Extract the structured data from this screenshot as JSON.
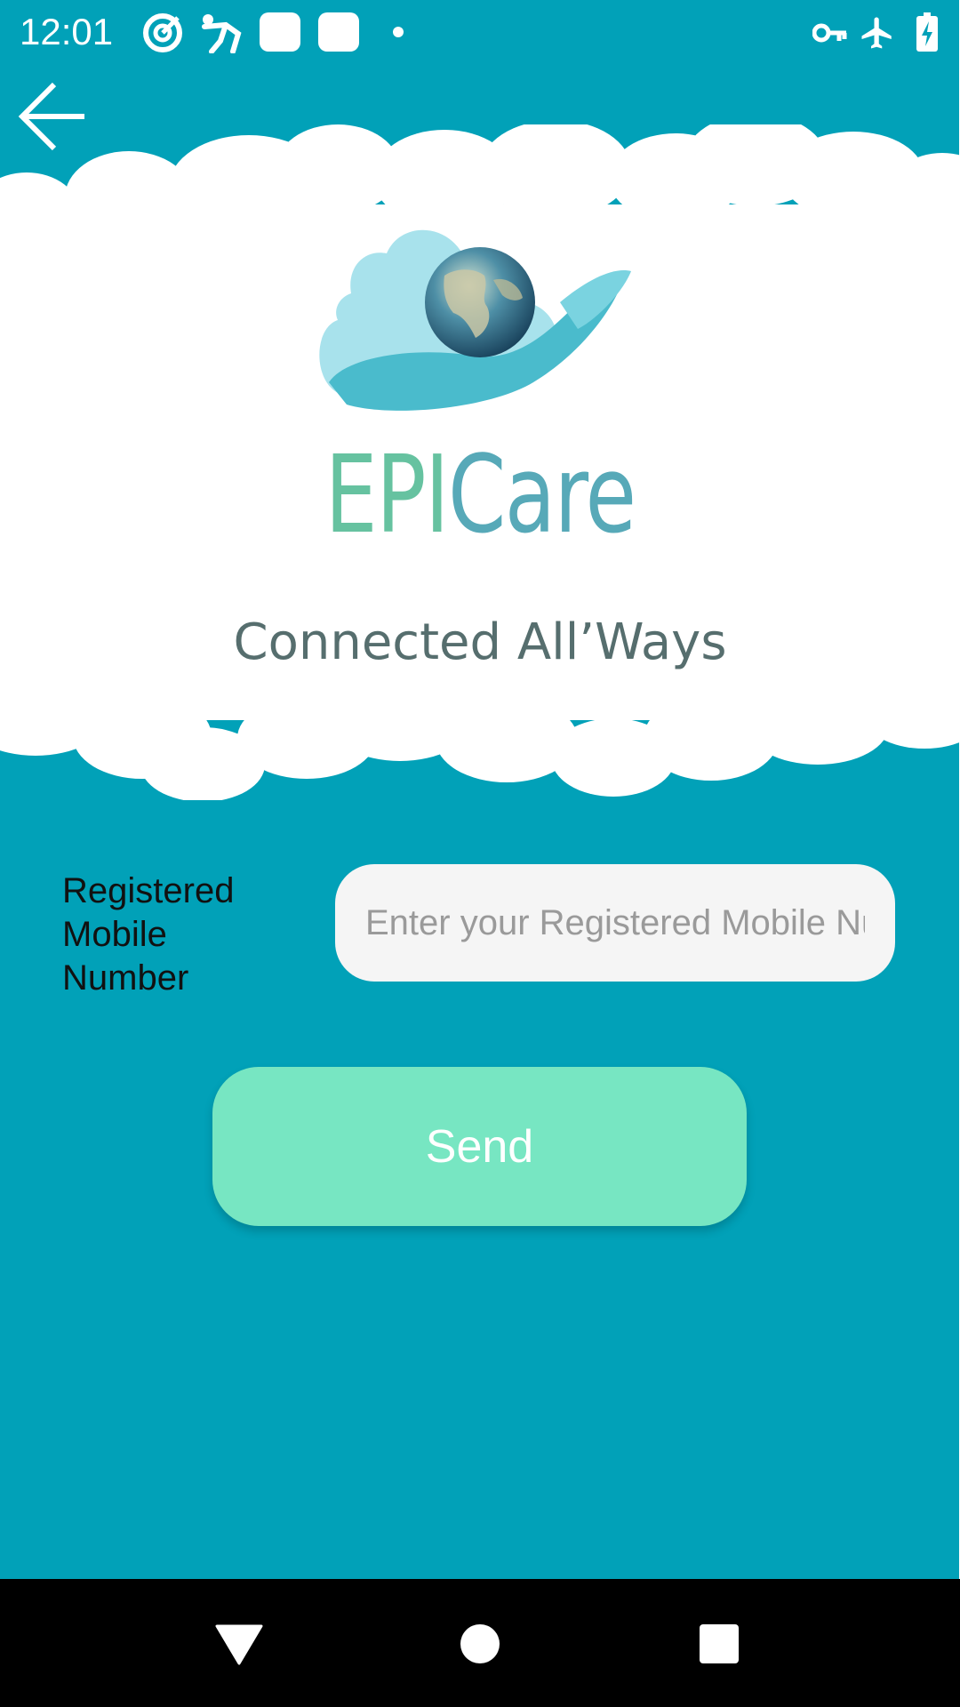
{
  "status_bar": {
    "time": "12:01",
    "icons": [
      "target-icon",
      "runner-icon",
      "app-square-icon",
      "app-square-icon",
      "dot-icon",
      "vpn-key-icon",
      "airplane-mode-icon",
      "battery-charging-icon"
    ]
  },
  "header": {
    "back_icon": "arrow-back-icon"
  },
  "banner": {
    "brand_epi": "EPI",
    "brand_care": "Care",
    "tagline": "Connected All’Ways"
  },
  "form": {
    "mobile_label": "Registered Mobile Number",
    "mobile_value": "",
    "mobile_placeholder": "Enter your Registered Mobile Number",
    "send_label": "Send"
  },
  "nav_bar": {
    "back": "nav-back-icon",
    "home": "nav-home-icon",
    "recents": "nav-recents-icon"
  },
  "colors": {
    "background": "#01A1B8",
    "input_bg": "#F5F5F5",
    "send_button": "#77E6C2",
    "brand_epi": "#66C2A0",
    "brand_care": "#57A9B8",
    "tagline": "#566E6E"
  }
}
